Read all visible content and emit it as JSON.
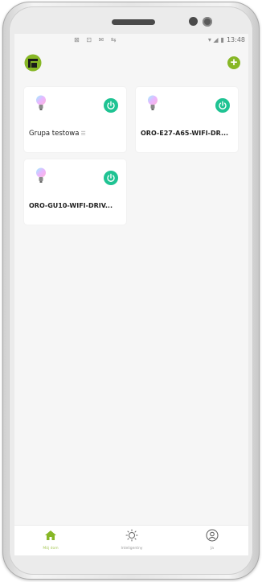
{
  "status_bar": {
    "left_icons": "⊠ ⊡ ✉ ⇆",
    "signal": "▾ ◢",
    "battery": "▮",
    "time": "13:48"
  },
  "header": {
    "add_icon": "plus-circle-icon"
  },
  "devices": [
    {
      "name": "Grupa testowa",
      "is_group": true,
      "power_on": true
    },
    {
      "name": "ORO-E27-A65-WIFI-DR...",
      "is_group": false,
      "power_on": true
    },
    {
      "name": "ORO-GU10-WIFI-DRIV...",
      "is_group": false,
      "power_on": true
    }
  ],
  "bottom_nav": [
    {
      "label": "Mój dom",
      "icon": "home-icon",
      "active": true
    },
    {
      "label": "Inteligentny",
      "icon": "sun-icon",
      "active": false
    },
    {
      "label": "Ja",
      "icon": "user-icon",
      "active": false
    }
  ],
  "colors": {
    "accent": "#87b726",
    "power": "#1fc393"
  }
}
